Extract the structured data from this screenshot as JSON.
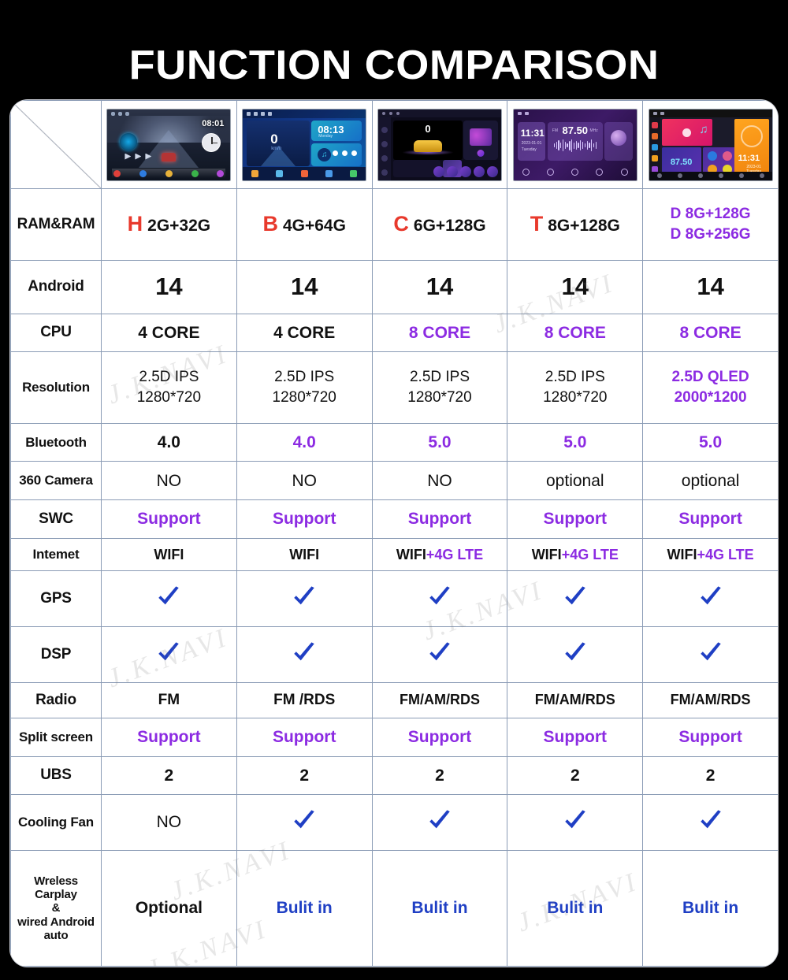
{
  "title": "FUNCTION COMPARISON",
  "colors": {
    "accent_purple": "#8c2be2",
    "accent_red": "#e8392c",
    "accent_blue": "#1f3fc4",
    "check_blue": "#1f3fc4",
    "border": "#8a9bb5",
    "title_text": "#ffffff",
    "page_bg": "#000000"
  },
  "devices": [
    {
      "id": "dev-h",
      "screen_time": "08:01",
      "screen_label": "speedometer-night-road-ui"
    },
    {
      "id": "dev-b",
      "screen_time": "08:13",
      "screen_speed": "0",
      "screen_label": "blue-gradient-dashboard-ui"
    },
    {
      "id": "dev-c",
      "screen_speed": "0",
      "screen_label": "dark-sportscar-ui"
    },
    {
      "id": "dev-t",
      "screen_time": "11:31",
      "screen_freq": "87.50",
      "screen_label": "purple-radio-ui"
    },
    {
      "id": "dev-d",
      "screen_time": "11:31",
      "screen_freq": "87.50",
      "screen_label": "colorful-tiles-ui"
    }
  ],
  "rows": [
    {
      "label": "RAM&RAM",
      "type": "ram",
      "cells": [
        {
          "tag": "H",
          "text": "2G+32G",
          "tag_color": "red",
          "text_color": "black"
        },
        {
          "tag": "B",
          "text": "4G+64G",
          "tag_color": "red",
          "text_color": "black"
        },
        {
          "tag": "C",
          "text": "6G+128G",
          "tag_color": "red",
          "text_color": "black"
        },
        {
          "tag": "T",
          "text": "8G+128G",
          "tag_color": "red",
          "text_color": "black"
        },
        {
          "lines": [
            "D 8G+128G",
            "D 8G+256G"
          ],
          "color": "purple"
        }
      ]
    },
    {
      "label": "Android",
      "type": "big",
      "cells": [
        {
          "text": "14"
        },
        {
          "text": "14"
        },
        {
          "text": "14"
        },
        {
          "text": "14"
        },
        {
          "text": "14"
        }
      ]
    },
    {
      "label": "CPU",
      "type": "text",
      "cells": [
        {
          "text": "4 CORE",
          "color": "black"
        },
        {
          "text": "4 CORE",
          "color": "black"
        },
        {
          "text": "8 CORE",
          "color": "purple"
        },
        {
          "text": "8 CORE",
          "color": "purple"
        },
        {
          "text": "8 CORE",
          "color": "purple"
        }
      ]
    },
    {
      "label": "Resolution",
      "type": "multiline",
      "cells": [
        {
          "lines": [
            "2.5D IPS",
            "1280*720"
          ],
          "color": "black"
        },
        {
          "lines": [
            "2.5D IPS",
            "1280*720"
          ],
          "color": "black"
        },
        {
          "lines": [
            "2.5D IPS",
            "1280*720"
          ],
          "color": "black"
        },
        {
          "lines": [
            "2.5D IPS",
            "1280*720"
          ],
          "color": "black"
        },
        {
          "lines": [
            "2.5D QLED",
            "2000*1200"
          ],
          "color": "purple"
        }
      ]
    },
    {
      "label": "Bluetooth",
      "type": "text",
      "cells": [
        {
          "text": "4.0",
          "color": "black"
        },
        {
          "text": "4.0",
          "color": "purple"
        },
        {
          "text": "5.0",
          "color": "purple"
        },
        {
          "text": "5.0",
          "color": "purple"
        },
        {
          "text": "5.0",
          "color": "purple"
        }
      ]
    },
    {
      "label": "360 Camera",
      "type": "light",
      "cells": [
        {
          "text": "NO",
          "color": "black"
        },
        {
          "text": "NO",
          "color": "black"
        },
        {
          "text": "NO",
          "color": "black"
        },
        {
          "text": "optional",
          "color": "black"
        },
        {
          "text": "optional",
          "color": "black"
        }
      ]
    },
    {
      "label": "SWC",
      "type": "text",
      "cells": [
        {
          "text": "Support",
          "color": "purple"
        },
        {
          "text": "Support",
          "color": "purple"
        },
        {
          "text": "Support",
          "color": "purple"
        },
        {
          "text": "Support",
          "color": "purple"
        },
        {
          "text": "Support",
          "color": "purple"
        }
      ]
    },
    {
      "label": "Intemet",
      "type": "wifi",
      "cells": [
        {
          "black": "WIFI",
          "purple": ""
        },
        {
          "black": "WIFI",
          "purple": ""
        },
        {
          "black": "WIFI",
          "purple": "+4G LTE"
        },
        {
          "black": "WIFI",
          "purple": "+4G LTE"
        },
        {
          "black": "WIFI",
          "purple": "+4G LTE"
        }
      ]
    },
    {
      "label": "GPS",
      "type": "check",
      "cells": [
        {
          "icon": "checkmark-icon"
        },
        {
          "icon": "checkmark-icon"
        },
        {
          "icon": "checkmark-icon"
        },
        {
          "icon": "checkmark-icon"
        },
        {
          "icon": "checkmark-icon"
        }
      ]
    },
    {
      "label": "DSP",
      "type": "check",
      "cells": [
        {
          "icon": "checkmark-icon"
        },
        {
          "icon": "checkmark-icon"
        },
        {
          "icon": "checkmark-icon"
        },
        {
          "icon": "checkmark-icon"
        },
        {
          "icon": "checkmark-icon"
        }
      ]
    },
    {
      "label": "Radio",
      "type": "radio",
      "cells": [
        {
          "text": "FM",
          "color": "black"
        },
        {
          "text": "FM /RDS",
          "color": "black"
        },
        {
          "text": "FM/AM/RDS",
          "color": "black"
        },
        {
          "text": "FM/AM/RDS",
          "color": "black"
        },
        {
          "text": "FM/AM/RDS",
          "color": "black"
        }
      ]
    },
    {
      "label": "Split screen",
      "type": "text",
      "cells": [
        {
          "text": "Support",
          "color": "purple"
        },
        {
          "text": "Support",
          "color": "purple"
        },
        {
          "text": "Support",
          "color": "purple"
        },
        {
          "text": "Support",
          "color": "purple"
        },
        {
          "text": "Support",
          "color": "purple"
        }
      ]
    },
    {
      "label": "UBS",
      "type": "text",
      "cells": [
        {
          "text": "2",
          "color": "black"
        },
        {
          "text": "2",
          "color": "black"
        },
        {
          "text": "2",
          "color": "black"
        },
        {
          "text": "2",
          "color": "black"
        },
        {
          "text": "2",
          "color": "black"
        }
      ]
    },
    {
      "label": "Cooling Fan",
      "type": "mixed",
      "cells": [
        {
          "text": "NO",
          "color": "black"
        },
        {
          "icon": "checkmark-icon"
        },
        {
          "icon": "checkmark-icon"
        },
        {
          "icon": "checkmark-icon"
        },
        {
          "icon": "checkmark-icon"
        }
      ]
    },
    {
      "label": "Wreless Carplay\n&\nwired Android\nauto",
      "label_lines": [
        "Wreless Carplay",
        "&",
        "wired Android",
        "auto"
      ],
      "type": "text",
      "cells": [
        {
          "text": "Optional",
          "color": "black"
        },
        {
          "text": "Bulit in",
          "color": "blue"
        },
        {
          "text": "Bulit in",
          "color": "blue"
        },
        {
          "text": "Bulit in",
          "color": "blue"
        },
        {
          "text": "Bulit in",
          "color": "blue"
        }
      ]
    }
  ]
}
